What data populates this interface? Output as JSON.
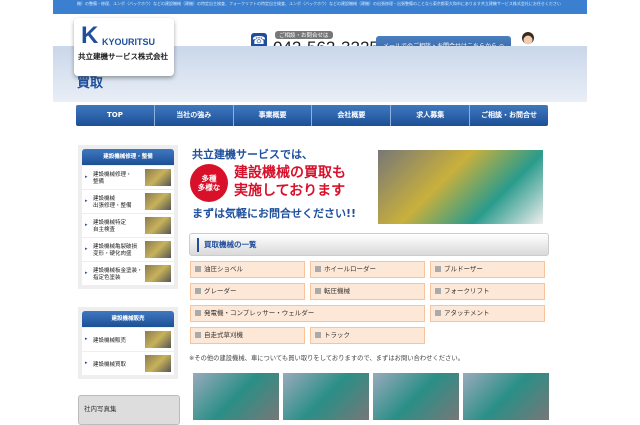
{
  "topbar": {
    "text": "機）の整備・修理、ユンボ（バックホウ）などの建設機械（建機）の特定自主検査、フォークリフトの特定自主検査、ユンボ（バックホウ）などの建設機械（建機）の出張修理・出張整備のことなら東京都東大和市にあります共立建機サービス株式会社にお任せください"
  },
  "header": {
    "logo_letter": "K",
    "logo_brand": "KYOURITSU",
    "logo_company": "共立建機サービス株式会社",
    "tel_label": "ご相談・お問合せは",
    "tel": "042-562-3225",
    "mail_button": "メールでのご相談・お問合せはこちらから ⊙",
    "icons": {
      "phone": "phone-icon"
    }
  },
  "page_title": "買取",
  "nav": [
    "TOP",
    "当社の強み",
    "事業概要",
    "会社概要",
    "求人募集",
    "ご相談・お問合せ"
  ],
  "sidebar": {
    "repair": {
      "title": "建設機械修理・整備",
      "items": [
        [
          "建設機械修理・",
          "整備"
        ],
        [
          "建設機械",
          "出張修理・整備"
        ],
        [
          "建設機械特定",
          "自主検査"
        ],
        [
          "建設機械亀裂破損",
          "変形・硬化肉盛"
        ],
        [
          "建設機械板金塗装・",
          "指定色塗装"
        ]
      ]
    },
    "sales": {
      "title": "建設機械販売",
      "items": [
        [
          "建設機械販売",
          ""
        ],
        [
          "建設機械買取",
          ""
        ]
      ]
    },
    "photos": "社内写真集"
  },
  "hero": {
    "line1": "共立建機サービスでは、",
    "badge1": "多種",
    "badge2": "多様な",
    "line2a": "建設機械の買取も",
    "line2b": "実施しております",
    "line3": "まずは気軽にお問合せください!!"
  },
  "list": {
    "title": "買取機械の一覧",
    "items": [
      "油圧ショベル",
      "ホイールローダー",
      "ブルドーザー",
      "グレーダー",
      "転圧機械",
      "フォークリフト",
      "発電機・コンプレッサー・ウェルダー",
      "アタッチメント",
      "自走式草刈機",
      "トラック"
    ]
  },
  "note": "※その他の建設機械、車についても買い取りをしておりますので、まずはお問い合わせください。",
  "colors": {
    "brand": "#1f4f9c",
    "accent": "#d8102a",
    "cell": "#fde8d8"
  }
}
